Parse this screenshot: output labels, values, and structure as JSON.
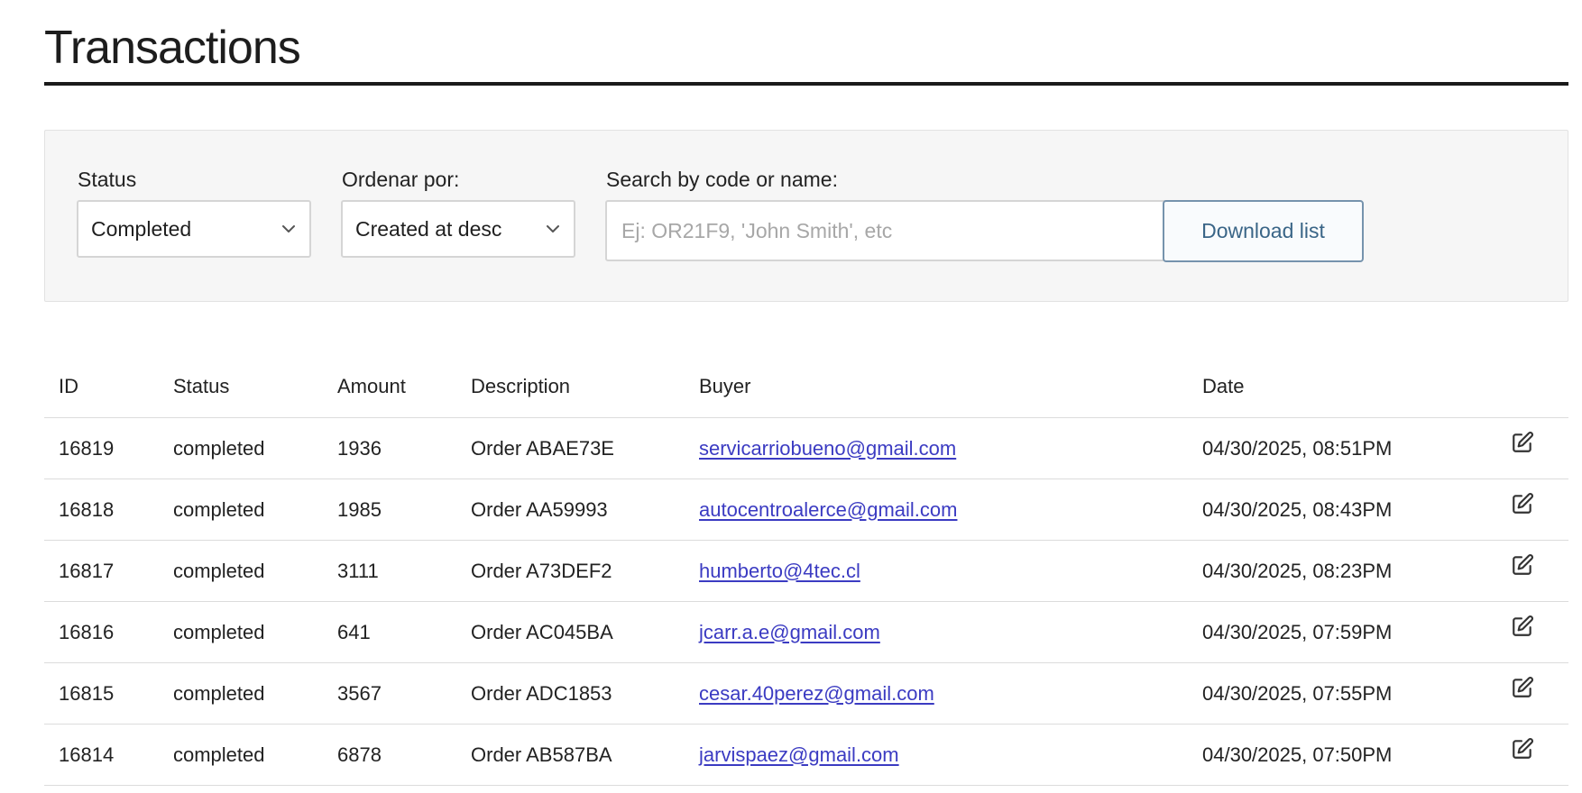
{
  "page": {
    "title": "Transactions"
  },
  "filters": {
    "status": {
      "label": "Status",
      "selected": "Completed"
    },
    "order_by": {
      "label": "Ordenar por:",
      "selected": "Created at desc"
    },
    "search": {
      "label": "Search by code or name:",
      "value": "",
      "placeholder": "Ej: OR21F9, 'John Smith', etc"
    },
    "download_label": "Download list"
  },
  "table": {
    "columns": [
      "ID",
      "Status",
      "Amount",
      "Description",
      "Buyer",
      "Date"
    ],
    "rows": [
      {
        "id": "16819",
        "status": "completed",
        "amount": "1936",
        "description": "Order ABAE73E",
        "buyer": "servicarriobueno@gmail.com",
        "date": "04/30/2025, 08:51PM"
      },
      {
        "id": "16818",
        "status": "completed",
        "amount": "1985",
        "description": "Order AA59993",
        "buyer": "autocentroalerce@gmail.com",
        "date": "04/30/2025, 08:43PM"
      },
      {
        "id": "16817",
        "status": "completed",
        "amount": "3111",
        "description": "Order A73DEF2",
        "buyer": "humberto@4tec.cl",
        "date": "04/30/2025, 08:23PM"
      },
      {
        "id": "16816",
        "status": "completed",
        "amount": "641",
        "description": "Order AC045BA",
        "buyer": "jcarr.a.e@gmail.com",
        "date": "04/30/2025, 07:59PM"
      },
      {
        "id": "16815",
        "status": "completed",
        "amount": "3567",
        "description": "Order ADC1853",
        "buyer": "cesar.40perez@gmail.com",
        "date": "04/30/2025, 07:55PM"
      },
      {
        "id": "16814",
        "status": "completed",
        "amount": "6878",
        "description": "Order AB587BA",
        "buyer": "jarvispaez@gmail.com",
        "date": "04/30/2025, 07:50PM"
      }
    ]
  },
  "icons": {
    "chevron": "chevron-down-icon",
    "edit": "edit-icon"
  }
}
